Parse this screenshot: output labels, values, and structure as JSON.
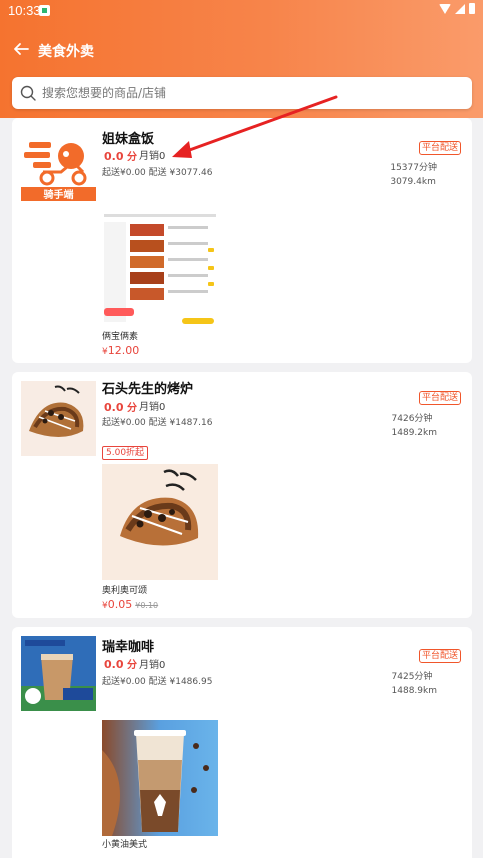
{
  "status_bar": {
    "time": "10:33"
  },
  "header": {
    "title": "美食外卖",
    "back_icon": "arrow-left-icon"
  },
  "search": {
    "placeholder": "搜索您想要的商品/店铺"
  },
  "colors": {
    "accent": "#f5732f",
    "price_red": "#e8453c",
    "badge_orange": "#f0562b"
  },
  "stores": [
    {
      "name": "姐妹盒饭",
      "score": "0.0",
      "score_unit": "分",
      "sales": "月销0",
      "fee": "起送¥0.00 配送 ¥3077.46",
      "badge": "平台配送",
      "time": "15377分钟",
      "distance": "3079.4km",
      "logo_text": "骑手端",
      "product": {
        "name": "俩宝俩素",
        "price": "12.00",
        "currency": "¥"
      }
    },
    {
      "name": "石头先生的烤炉",
      "score": "0.0",
      "score_unit": "分",
      "sales": "月销0",
      "fee": "起送¥0.00 配送 ¥1487.16",
      "badge": "平台配送",
      "time": "7426分钟",
      "distance": "1489.2km",
      "discount": "5.00折起",
      "product": {
        "name": "奥利奥可颂",
        "price": "0.05",
        "currency": "¥",
        "original": "¥0.10"
      }
    },
    {
      "name": "瑞幸咖啡",
      "score": "0.0",
      "score_unit": "分",
      "sales": "月销0",
      "fee": "起送¥0.00 配送 ¥1486.95",
      "badge": "平台配送",
      "time": "7425分钟",
      "distance": "1488.9km",
      "product": {
        "name": "小黄油美式"
      }
    }
  ]
}
